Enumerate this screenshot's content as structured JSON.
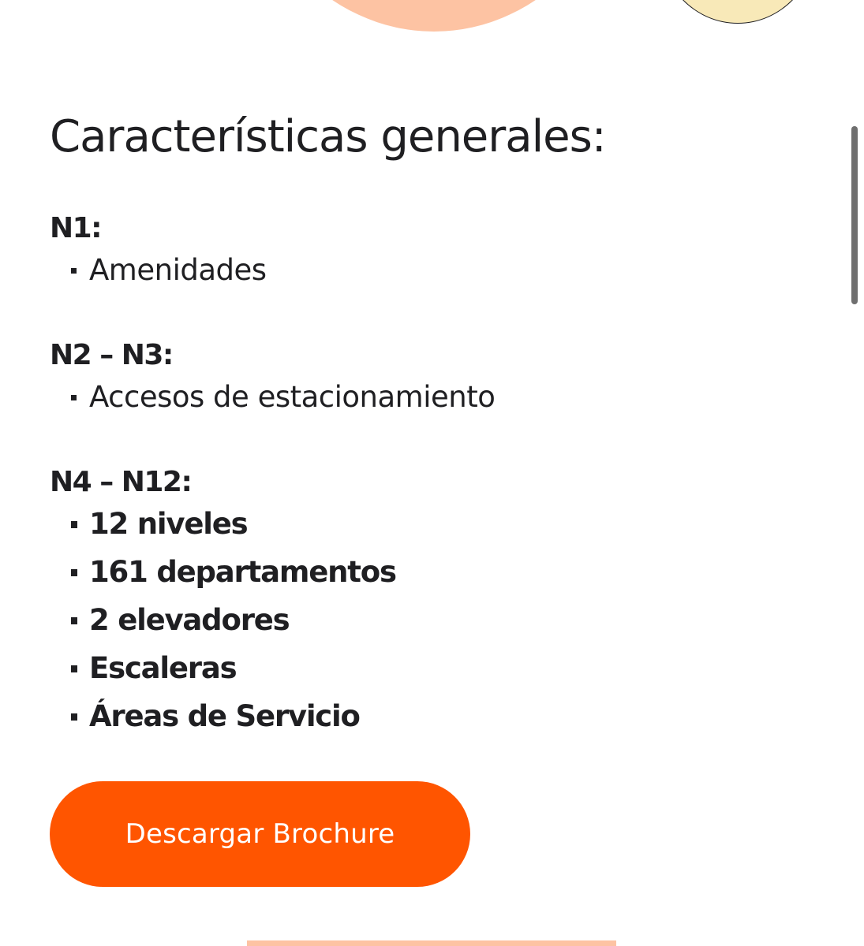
{
  "section": {
    "title": "Características generales:"
  },
  "levels": [
    {
      "heading": "N1:",
      "items": [
        "Amenidades"
      ]
    },
    {
      "heading": "N2 – N3:",
      "items": [
        "Accesos de estacionamiento"
      ]
    },
    {
      "heading": "N4 – N12:",
      "items": [
        "12 niveles",
        "161 departamentos",
        "2 elevadores",
        "Escaleras",
        "Áreas de Servicio"
      ]
    }
  ],
  "cta": {
    "label": "Descargar Brochure"
  },
  "colors": {
    "accent": "#ff5500",
    "peach": "#fdc3a3",
    "cream": "#f8e9b8",
    "text": "#1f1f22"
  }
}
